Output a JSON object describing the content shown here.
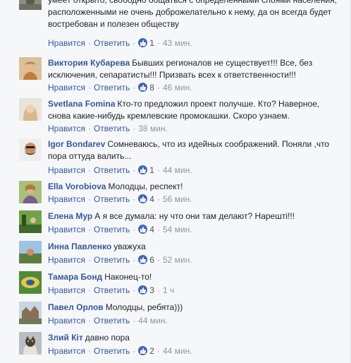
{
  "comments": [
    {
      "author": "",
      "text": "умеет открыто, свободно общаться с определенными слоями населения, расположенными не очень доброжелательно к нему, да он всегда будет востребован и полезен обществу",
      "like_label": "Нравится",
      "reply_label": "Ответить",
      "likes": "1",
      "time": "43 мин."
    },
    {
      "author": "Виктория Кубарева",
      "text": "Бывших регионалов не существует!!! Все, без исключения, сепаратисты!!! Призвать всех к ответственности!!!",
      "like_label": "Нравится",
      "reply_label": "Ответить",
      "likes": "8",
      "time": "46 мин."
    },
    {
      "author": "Svetlana Fomina",
      "text": "Кто-то предложил проект получше. Кто? Наверное, снова какие-нибудь кремлевские промокашки. Скоро узнаем.",
      "like_label": "Нравится",
      "reply_label": "Ответить",
      "likes": "",
      "time": "38 мин."
    },
    {
      "author": "Igor Bondarev",
      "text": "Сомневаюсь, что из идейных соображений. Поняли ,что пора оттуда валить...",
      "like_label": "Нравится",
      "reply_label": "Ответить",
      "likes": "1",
      "time": "44 мин."
    },
    {
      "author": "Ella Vorobiova",
      "text": "Молодцы, респект!",
      "like_label": "Нравится",
      "reply_label": "Ответить",
      "likes": "4",
      "time": "56 мин."
    },
    {
      "author": "Елена Мур",
      "text": "А я все думала: ну что они там делают? Нарештi!!!",
      "like_label": "Нравится",
      "reply_label": "Ответить",
      "likes": "4",
      "time": "54 мин."
    },
    {
      "author": "Инна Павленко",
      "text": "уважуха",
      "like_label": "Нравится",
      "reply_label": "Ответить",
      "likes": "6",
      "time": "52 мин."
    },
    {
      "author": "Тамара Бонд",
      "text": "Наконец-то!",
      "like_label": "Нравится",
      "reply_label": "Ответить",
      "likes": "3",
      "time": "1 ч"
    },
    {
      "author": "Павел Орлов",
      "text": "Молодцы, ребята)))",
      "like_label": "Нравится",
      "reply_label": "Ответить",
      "likes": "",
      "time": "44 мин."
    },
    {
      "author": "Злий Кiт",
      "text": "давно пора",
      "like_label": "Нравится",
      "reply_label": "Ответить",
      "likes": "2",
      "time": "44 мин."
    }
  ],
  "colors": {
    "author_link": "#365899",
    "like_badge": "#4267b2",
    "meta_gray": "#90949c",
    "background": "#f6f7f9"
  }
}
